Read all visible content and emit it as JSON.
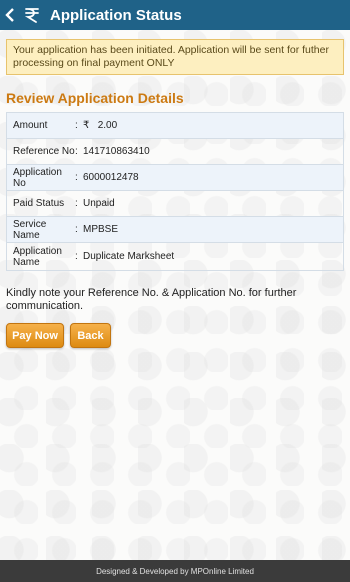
{
  "appbar": {
    "title": "Application Status",
    "back_icon": "chevron-left-icon",
    "logo_icon": "rupee-logo-icon",
    "color": "#1f6288"
  },
  "notice": {
    "text": "Your application has been initiated. Application will be sent for futher processing on final payment ONLY"
  },
  "section": {
    "title": "Review Application Details"
  },
  "details": {
    "separator": ":",
    "rows": [
      {
        "label": "Amount",
        "value": "2.00",
        "currency": "₹"
      },
      {
        "label": "Reference No",
        "value": "141710863410"
      },
      {
        "label": "Application No",
        "value": "6000012478"
      },
      {
        "label": "Paid Status",
        "value": "Unpaid"
      },
      {
        "label": "Service Name",
        "value": "MPBSE"
      },
      {
        "label": "Application Name",
        "value": "Duplicate Marksheet"
      }
    ]
  },
  "note": {
    "text": "Kindly note your Reference No. & Application No. for further communication."
  },
  "buttons": {
    "pay_now": "Pay Now",
    "back": "Back",
    "accent": "#dd8b12"
  },
  "footer": {
    "text": "Designed & Developed by MPOnline Limited"
  }
}
